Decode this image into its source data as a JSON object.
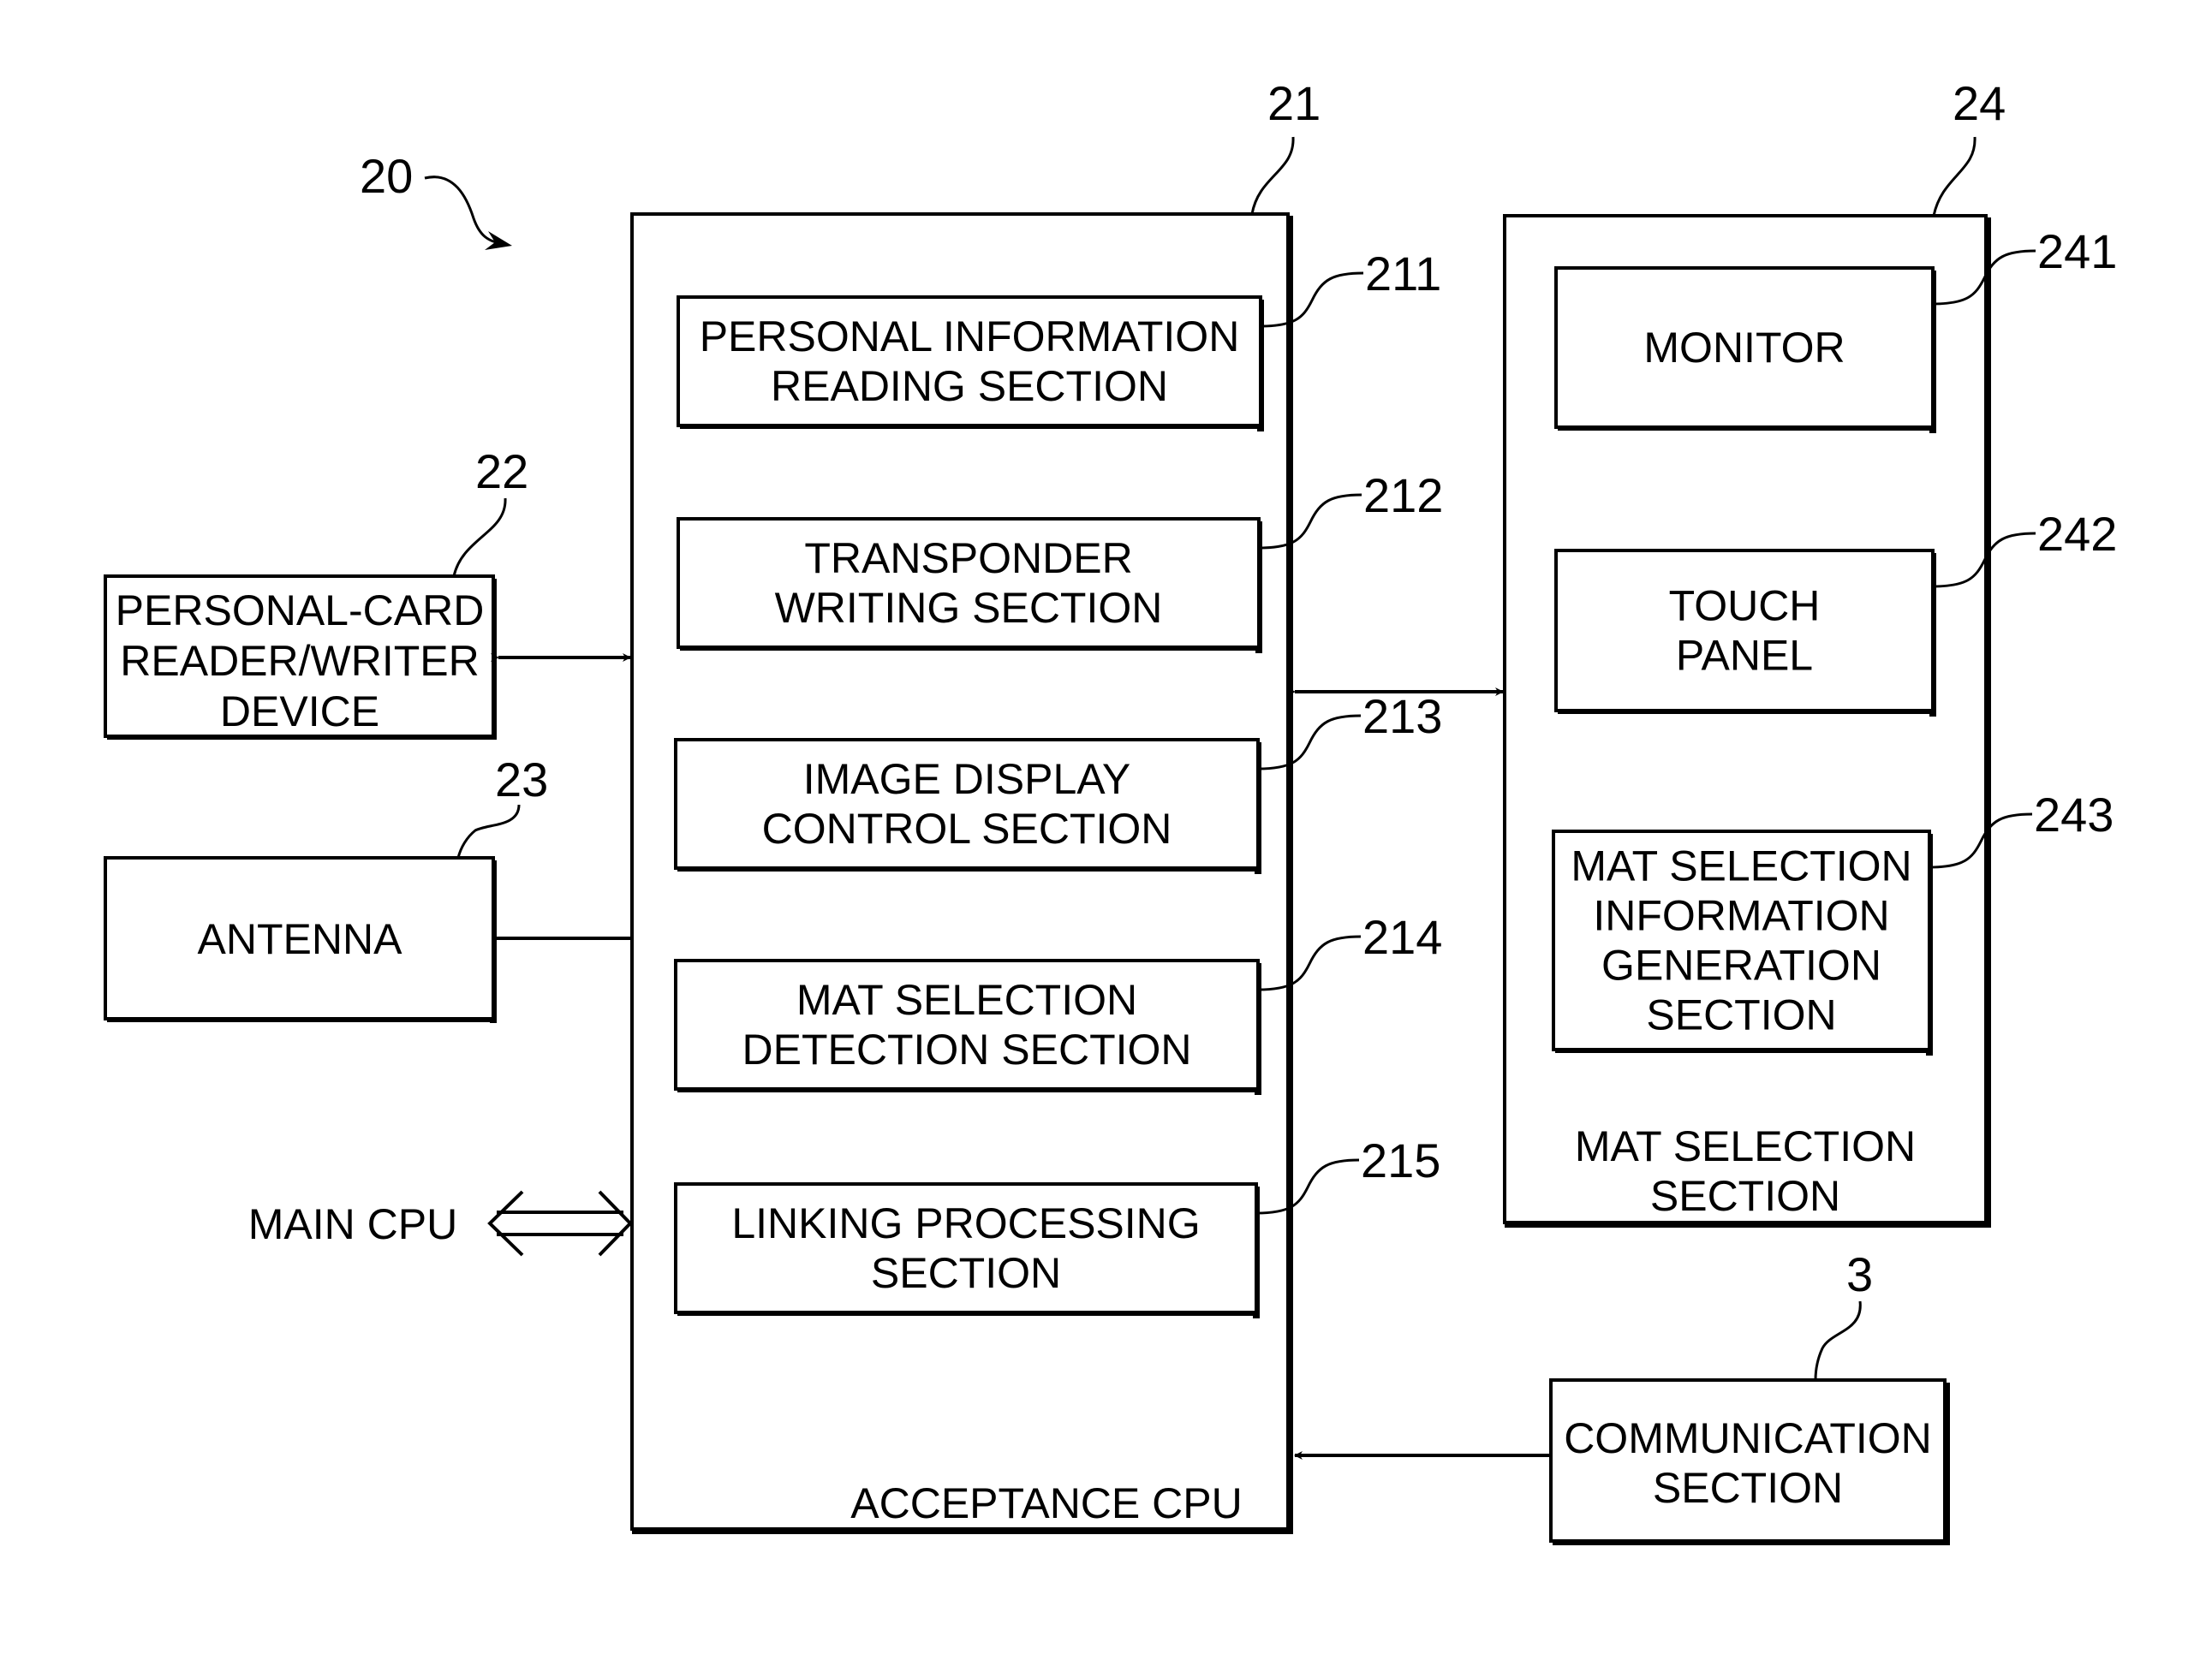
{
  "figure": {
    "reference": "20",
    "acceptance_cpu": {
      "reference": "21",
      "label": "ACCEPTANCE CPU",
      "sections": [
        {
          "reference": "211",
          "lines": [
            "PERSONAL INFORMATION",
            "READING SECTION"
          ]
        },
        {
          "reference": "212",
          "lines": [
            "TRANSPONDER",
            "WRITING SECTION"
          ]
        },
        {
          "reference": "213",
          "lines": [
            "IMAGE DISPLAY",
            "CONTROL SECTION"
          ]
        },
        {
          "reference": "214",
          "lines": [
            "MAT SELECTION",
            "DETECTION SECTION"
          ]
        },
        {
          "reference": "215",
          "lines": [
            "LINKING PROCESSING",
            "SECTION"
          ]
        }
      ]
    },
    "card_reader": {
      "reference": "22",
      "lines": [
        "PERSONAL-CARD",
        "READER/WRITER",
        "DEVICE"
      ]
    },
    "antenna": {
      "reference": "23",
      "lines": [
        "ANTENNA"
      ]
    },
    "main_cpu": {
      "label": "MAIN CPU"
    },
    "mat_selection_section": {
      "reference": "24",
      "label_lines": [
        "MAT SELECTION",
        "SECTION"
      ],
      "sections": [
        {
          "reference": "241",
          "lines": [
            "MONITOR"
          ]
        },
        {
          "reference": "242",
          "lines": [
            "TOUCH",
            "PANEL"
          ]
        },
        {
          "reference": "243",
          "lines": [
            "MAT SELECTION",
            "INFORMATION",
            "GENERATION",
            "SECTION"
          ]
        }
      ]
    },
    "communication_section": {
      "reference": "3",
      "lines": [
        "COMMUNICATION",
        "SECTION"
      ]
    }
  }
}
